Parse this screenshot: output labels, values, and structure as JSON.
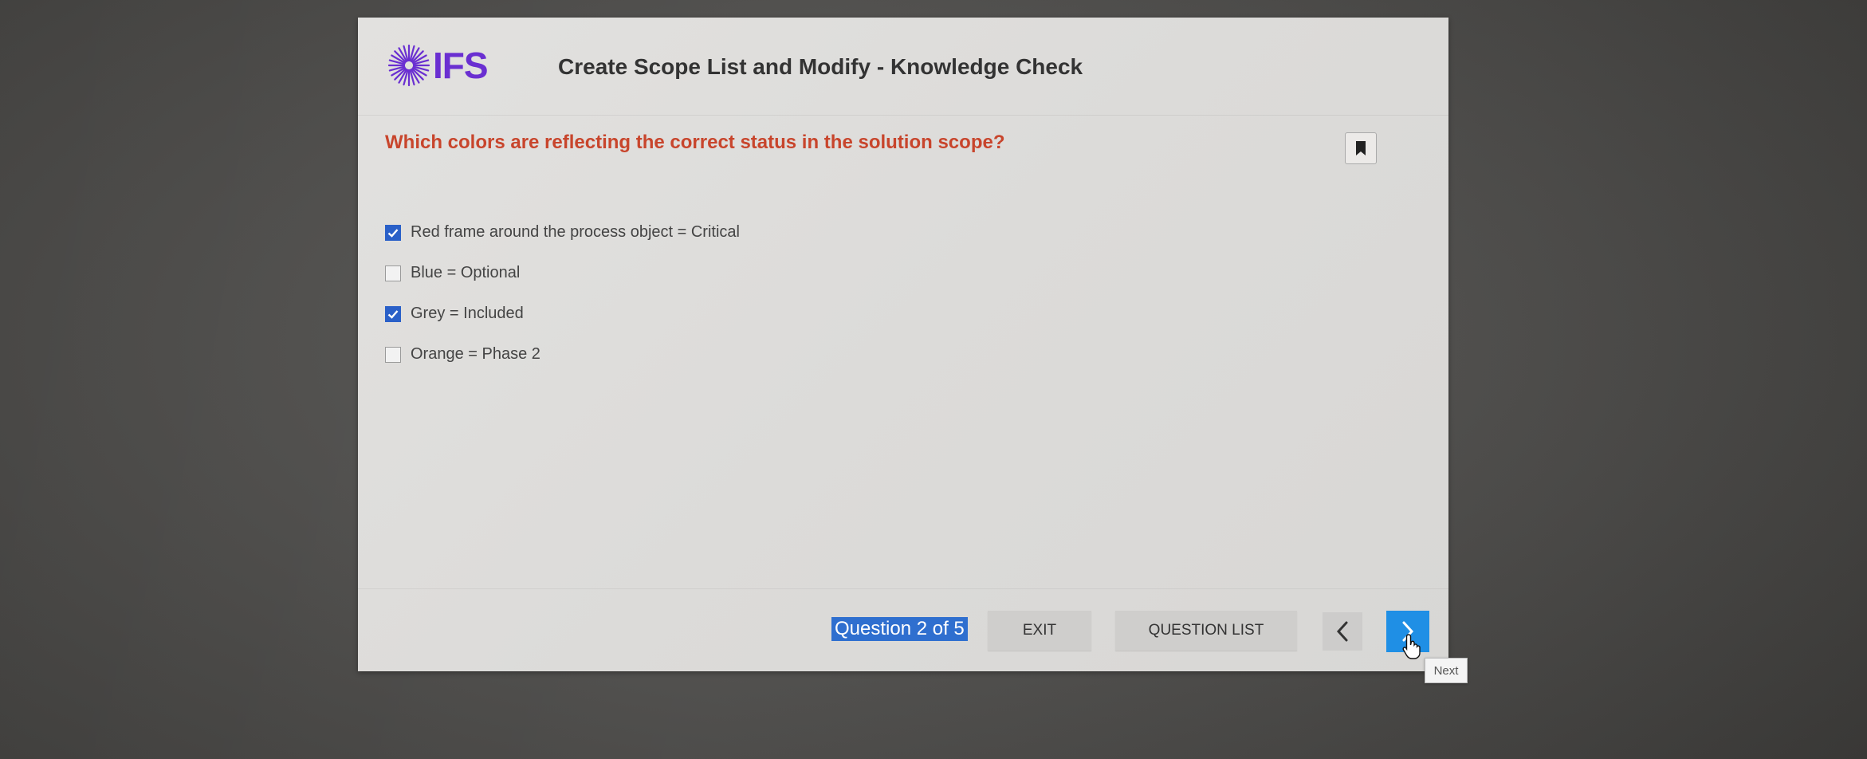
{
  "header": {
    "logo_text": "IFS",
    "course_title": "Create Scope List and Modify - Knowledge Check"
  },
  "question": {
    "text": "Which colors are reflecting the correct status in the solution scope?",
    "options": [
      {
        "label": "Red frame around the process object = Critical",
        "checked": true
      },
      {
        "label": "Blue = Optional",
        "checked": false
      },
      {
        "label": "Grey = Included",
        "checked": true
      },
      {
        "label": "Orange = Phase 2",
        "checked": false
      }
    ]
  },
  "footer": {
    "progress": "Question 2 of 5",
    "exit_label": "EXIT",
    "question_list_label": "QUESTION LIST",
    "next_tooltip": "Next"
  },
  "icons": {
    "logo": "ifs-burst-logo-icon",
    "bookmark": "bookmark-icon",
    "prev": "chevron-left-icon",
    "next": "chevron-right-icon",
    "cursor": "hand-pointer-icon"
  },
  "colors": {
    "brand": "#6a2fd1",
    "question": "#c8452c",
    "checkbox_checked": "#2a60c8",
    "next_button": "#1f8fe5",
    "progress_highlight": "#2f6fcf"
  }
}
